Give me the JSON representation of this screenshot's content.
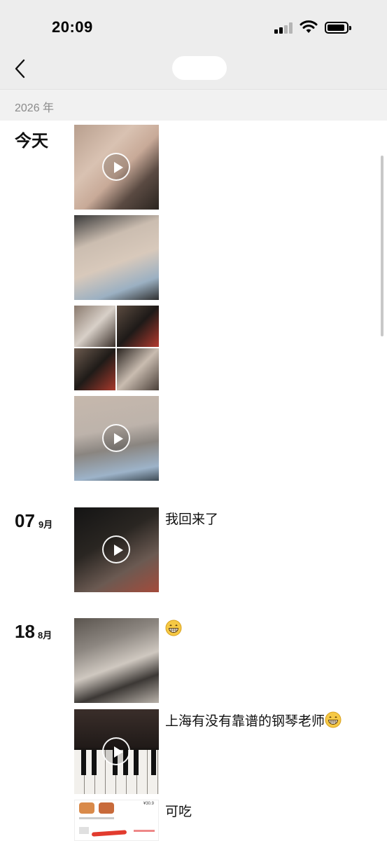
{
  "status_bar": {
    "time": "20:09"
  },
  "section_header": {
    "year": "2026 年"
  },
  "entries": [
    {
      "date_label": "今天"
    },
    {
      "day": "07",
      "month": "9月",
      "caption": "我回来了"
    },
    {
      "day": "18",
      "month": "8月",
      "captions": [
        "",
        "上海有没有靠谱的钢琴老师",
        "可吃"
      ]
    }
  ],
  "icons": [
    "back-chevron-icon",
    "signal-icon",
    "wifi-icon",
    "battery-icon",
    "play-icon",
    "grinning-emoji-icon"
  ],
  "colors": {
    "header_bg": "#ededed",
    "year_bar_bg": "#f1f1f1",
    "year_text": "#8a8a8a"
  },
  "screenshot_text_in_thumb": {
    "price": "¥30.9"
  }
}
